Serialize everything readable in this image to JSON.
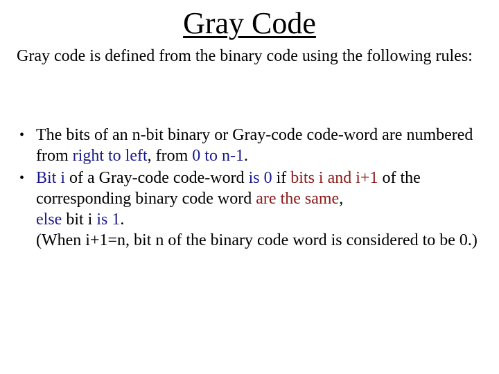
{
  "slide": {
    "title": "Gray Code",
    "intro": "Gray code is defined from the binary code using the following rules:",
    "bullet_glyph": "•",
    "colors": {
      "text": "#000000",
      "highlight_blue": "#1a1a8c",
      "highlight_red": "#8b1a1a"
    },
    "bullets": [
      {
        "segments": [
          {
            "text": "The bits of an n-bit binary or Gray-code code-word are numbered from ",
            "color": "default"
          },
          {
            "text": "right to left",
            "color": "blue"
          },
          {
            "text": ", from ",
            "color": "default"
          },
          {
            "text": "0 to n-1",
            "color": "blue"
          },
          {
            "text": ".",
            "color": "default"
          }
        ]
      },
      {
        "segments": [
          {
            "text": "Bit i",
            "color": "blue"
          },
          {
            "text": " of a Gray-code code-word ",
            "color": "default"
          },
          {
            "text": "is 0",
            "color": "blue"
          },
          {
            "text": " if ",
            "color": "default"
          },
          {
            "text": "bits i and i+1",
            "color": "red"
          },
          {
            "text": " of the corresponding binary code word ",
            "color": "default"
          },
          {
            "text": "are the same",
            "color": "red"
          },
          {
            "text": ",",
            "color": "default"
          }
        ],
        "continuation": [
          {
            "segments": [
              {
                "text": "else",
                "color": "blue"
              },
              {
                "text": " bit i ",
                "color": "default"
              },
              {
                "text": "is 1",
                "color": "blue"
              },
              {
                "text": ".",
                "color": "default"
              }
            ]
          },
          {
            "segments": [
              {
                "text": "(When i+1=n, bit n of the binary code word is considered to be 0.)",
                "color": "default"
              }
            ]
          }
        ]
      }
    ]
  }
}
